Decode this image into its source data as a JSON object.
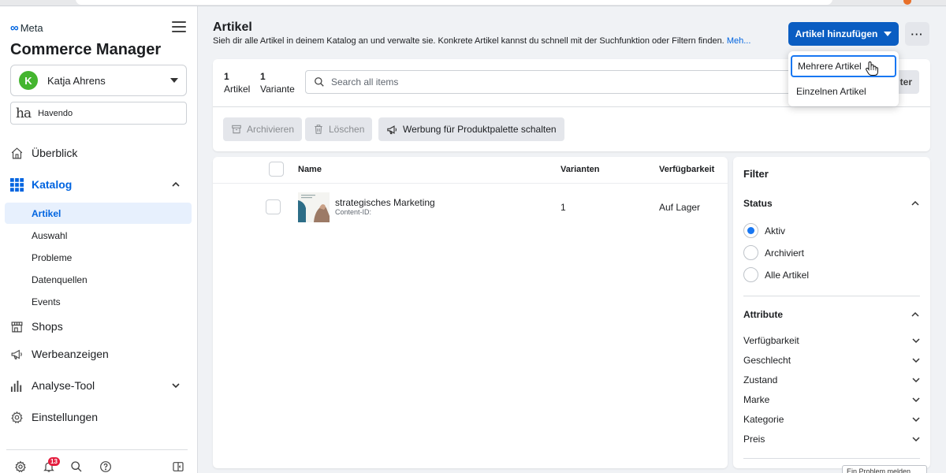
{
  "sidebar": {
    "brand": "Meta",
    "app_title": "Commerce Manager",
    "account": {
      "initial": "K",
      "name": "Katja Ahrens"
    },
    "business": {
      "logo": "ha",
      "name": "Havendo"
    },
    "nav": [
      {
        "label": "Überblick",
        "icon": "home-icon"
      },
      {
        "label": "Katalog",
        "icon": "grid-icon"
      },
      {
        "label": "Shops",
        "icon": "shop-icon"
      },
      {
        "label": "Werbeanzeigen",
        "icon": "megaphone-icon"
      },
      {
        "label": "Analyse-Tool",
        "icon": "bar-chart-icon"
      },
      {
        "label": "Einstellungen",
        "icon": "gear-icon"
      }
    ],
    "sub_items": [
      "Artikel",
      "Auswahl",
      "Probleme",
      "Datenquellen",
      "Events"
    ],
    "notifications_count": "13"
  },
  "header": {
    "title": "Artikel",
    "description": "Sieh dir alle Artikel in deinem Katalog an und verwalte sie. Konkrete Artikel kannst du schnell mit der Suchfunktion oder Filtern finden.",
    "more_link": "Meh...",
    "add_button": "Artikel hinzufügen",
    "more_button": "···"
  },
  "dropdown": {
    "items": [
      "Mehrere Artikel",
      "Einzelnen Artikel"
    ]
  },
  "summary": {
    "items_count": "1",
    "items_label": "Artikel",
    "variants_count": "1",
    "variants_label": "Variante"
  },
  "search": {
    "placeholder": "Search all items"
  },
  "filter_button": "ter",
  "toolbar": {
    "archive": "Archivieren",
    "delete": "Löschen",
    "advertise": "Werbung für Produktpalette schalten"
  },
  "table": {
    "columns": [
      "Name",
      "Varianten",
      "Verfügbarkeit"
    ],
    "rows": [
      {
        "name": "strategisches Marketing",
        "content_id": "Content-ID:",
        "variants": "1",
        "availability": "Auf Lager"
      }
    ]
  },
  "filter": {
    "title": "Filter",
    "status_label": "Status",
    "status_options": [
      "Aktiv",
      "Archiviert",
      "Alle Artikel"
    ],
    "selected_status": "Aktiv",
    "attributes_label": "Attribute",
    "attributes": [
      "Verfügbarkeit",
      "Geschlecht",
      "Zustand",
      "Marke",
      "Kategorie",
      "Preis"
    ]
  },
  "footer_snippet": "Ein Problem melden",
  "colors": {
    "accent": "#0a5dc2",
    "radio_selected": "#1877f2",
    "active_nav": "#0064e0",
    "badge": "#e41e3f"
  }
}
